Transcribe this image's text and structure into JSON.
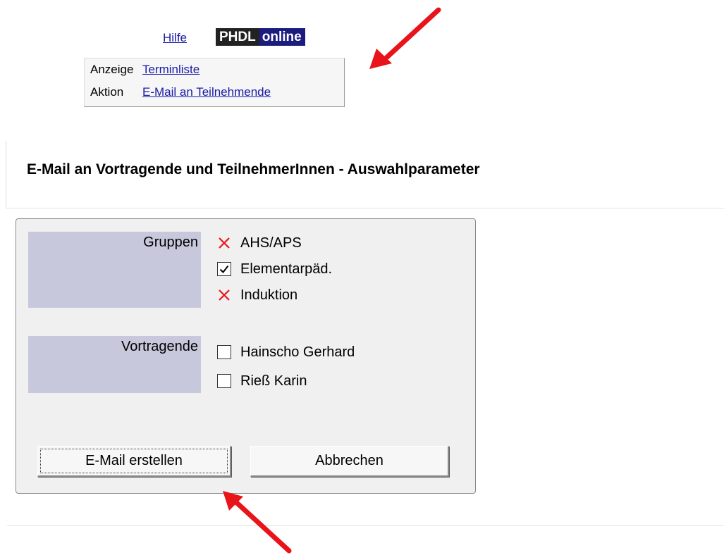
{
  "header": {
    "help_link": "Hilfe",
    "logo_part1": "PHDL",
    "logo_part2": "online"
  },
  "nav": {
    "rows": [
      {
        "label": "Anzeige",
        "link": "Terminliste"
      },
      {
        "label": "Aktion",
        "link": "E-Mail an Teilnehmende"
      }
    ]
  },
  "page": {
    "title": "E-Mail an Vortragende und TeilnehmerInnen - Auswahlparameter"
  },
  "form": {
    "groups_label": "Gruppen",
    "groups": [
      {
        "label": "AHS/APS",
        "state": "unavailable"
      },
      {
        "label": "Elementarpäd.",
        "state": "checked"
      },
      {
        "label": "Induktion",
        "state": "unavailable"
      }
    ],
    "speakers_label": "Vortragende",
    "speakers": [
      {
        "label": "Hainscho Gerhard",
        "state": "unchecked"
      },
      {
        "label": "Rieß Karin",
        "state": "unchecked"
      }
    ],
    "create_button": "E-Mail erstellen",
    "cancel_button": "Abbrechen"
  },
  "colors": {
    "arrow": "#e8141a",
    "label_bg": "#c8c8dd",
    "link": "#1a1aa6",
    "x_mark": "#e8141a"
  }
}
